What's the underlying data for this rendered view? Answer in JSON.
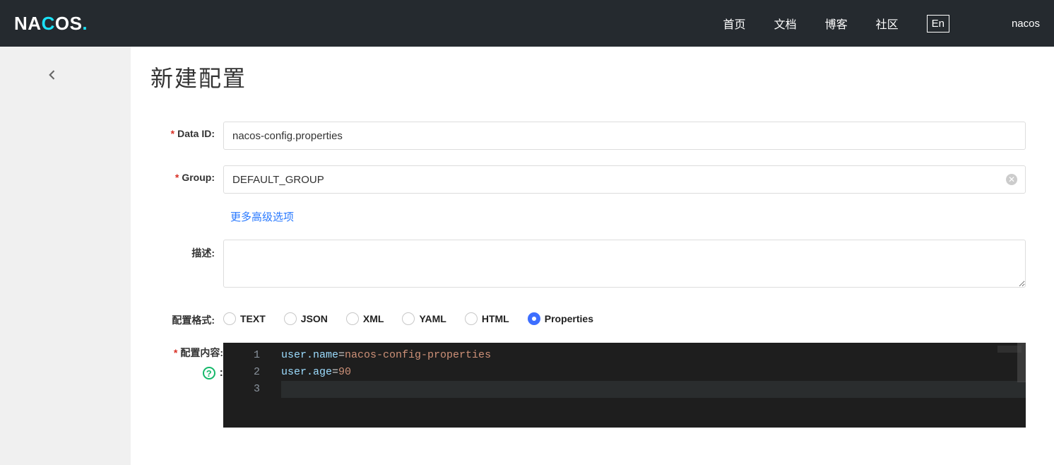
{
  "header": {
    "logo": "NACOS",
    "nav": {
      "home": "首页",
      "docs": "文档",
      "blog": "博客",
      "community": "社区"
    },
    "lang": "En",
    "user": "nacos"
  },
  "page": {
    "title": "新建配置"
  },
  "form": {
    "data_id": {
      "label": "Data ID:",
      "value": "nacos-config.properties"
    },
    "group": {
      "label": "Group:",
      "value": "DEFAULT_GROUP"
    },
    "more_link": "更多高级选项",
    "desc": {
      "label": "描述:",
      "value": ""
    },
    "format_label": "配置格式:",
    "formats": {
      "text": "TEXT",
      "json": "JSON",
      "xml": "XML",
      "yaml": "YAML",
      "html": "HTML",
      "properties": "Properties"
    },
    "selected_format": "properties",
    "content_label": "配置内容:"
  },
  "editor": {
    "lines": [
      {
        "n": "1",
        "key": "user.name",
        "op": "=",
        "val": "nacos-config-properties"
      },
      {
        "n": "2",
        "key": "user.age",
        "op": "=",
        "val": "90"
      },
      {
        "n": "3",
        "key": "",
        "op": "",
        "val": ""
      }
    ]
  }
}
